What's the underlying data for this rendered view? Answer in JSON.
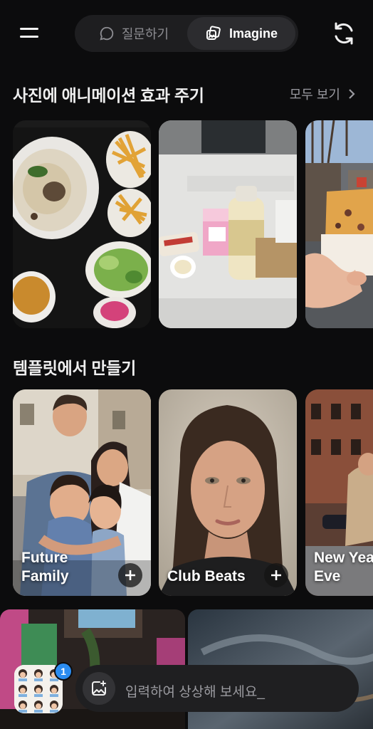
{
  "header": {
    "tabs": [
      {
        "label": "질문하기",
        "icon": "chat-bubble-icon",
        "active": false
      },
      {
        "label": "Imagine",
        "icon": "image-stack-icon",
        "active": true
      }
    ],
    "menu_icon": "menu-icon",
    "refresh_icon": "refresh-icon"
  },
  "animate_section": {
    "title": "사진에 애니메이션 효과 주기",
    "see_all": "모두 보기",
    "photos": [
      {
        "subject": "food-tray-photo"
      },
      {
        "subject": "table-items-photo"
      },
      {
        "subject": "hand-pastry-photo"
      }
    ]
  },
  "template_section": {
    "title": "템플릿에서 만들기",
    "templates": [
      {
        "label": "Future\nFamily"
      },
      {
        "label": "Club Beats"
      },
      {
        "label": "New Year\nEve"
      }
    ]
  },
  "composer": {
    "placeholder": "입력하여 상상해 보세요_",
    "badge_count": "1"
  },
  "colors": {
    "background": "#0c0c0d",
    "accent_blue": "#2b8cf0"
  }
}
